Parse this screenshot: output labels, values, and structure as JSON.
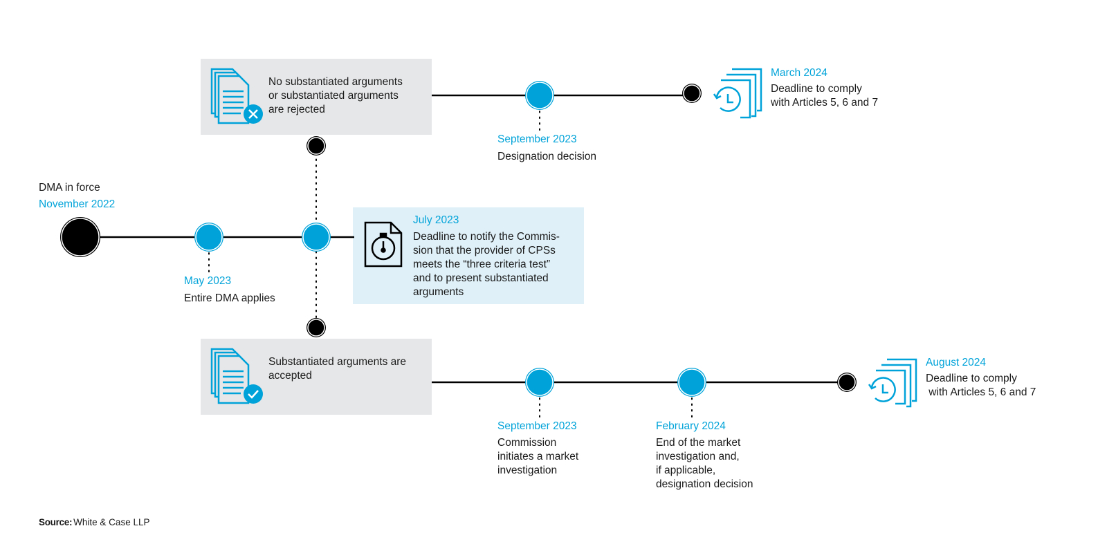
{
  "colors": {
    "accent": "#00a3d9",
    "line": "#000000",
    "panel_gray": "#e6e7e8",
    "panel_blue": "#dff0f8"
  },
  "start": {
    "title": "DMA in force",
    "date": "November 2022"
  },
  "milestones": {
    "may_2023": {
      "date": "May 2023",
      "text": "Entire DMA applies"
    },
    "july_2023": {
      "date": "July 2023",
      "text": "Deadline to notify the Commis-\nsion that the provider of CPSs\nmeets the “three criteria test”\nand to present substantiated\narguments",
      "icon": "stopwatch-document-icon"
    }
  },
  "branch_rejected": {
    "text": "No substantiated arguments\nor substantiated arguments\nare rejected",
    "icon": "documents-rejected-icon",
    "events": [
      {
        "date": "September 2023",
        "text": "Designation decision"
      }
    ],
    "deadline": {
      "date": "March 2024",
      "text": "Deadline to comply\nwith Articles 5, 6 and 7",
      "icon": "deadline-clock-icon"
    }
  },
  "branch_accepted": {
    "text": "Substantiated arguments are\naccepted",
    "icon": "documents-accepted-icon",
    "events": [
      {
        "date": "September 2023",
        "text": "Commission\ninitiates a market\ninvestigation"
      },
      {
        "date": "February 2024",
        "text": "End of the market\ninvestigation and,\nif applicable,\ndesignation decision"
      }
    ],
    "deadline": {
      "date": "August 2024",
      "text": "Deadline to comply\n with Articles 5, 6 and 7",
      "icon": "deadline-clock-icon"
    }
  },
  "source": {
    "label": "Source:",
    "value": "White & Case LLP"
  }
}
